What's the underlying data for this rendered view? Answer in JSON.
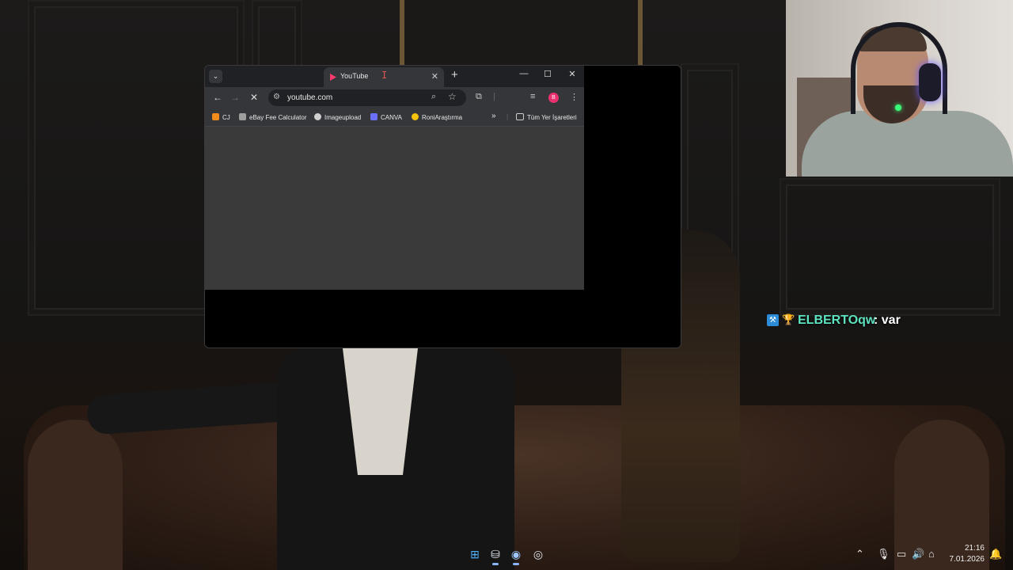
{
  "browser": {
    "tab": {
      "title": "YouTube"
    },
    "toolbar": {
      "url": "youtube.com",
      "profile_initial": "B"
    },
    "bookmarks": [
      {
        "label": "CJ",
        "color": "#f08c1b"
      },
      {
        "label": "eBay Fee Calculator",
        "color": "#9e9e9e"
      },
      {
        "label": "Imageupload",
        "color": "#d0d0d0"
      },
      {
        "label": "CANVA",
        "color": "#6b6ff5"
      },
      {
        "label": "RoniAraştırma",
        "color": "#f4c20d"
      }
    ],
    "all_bookmarks_label": "Tüm Yer İşaretleri"
  },
  "chat": {
    "username": "ELBERTOqw",
    "separator": ":",
    "message": "var"
  },
  "taskbar": {
    "time": "21:16",
    "date": "7.01.2026"
  },
  "colors": {
    "accent": "#8ab4f8",
    "chat_user": "#5ee3c0",
    "tab_favicon": "#ff3b6b"
  }
}
